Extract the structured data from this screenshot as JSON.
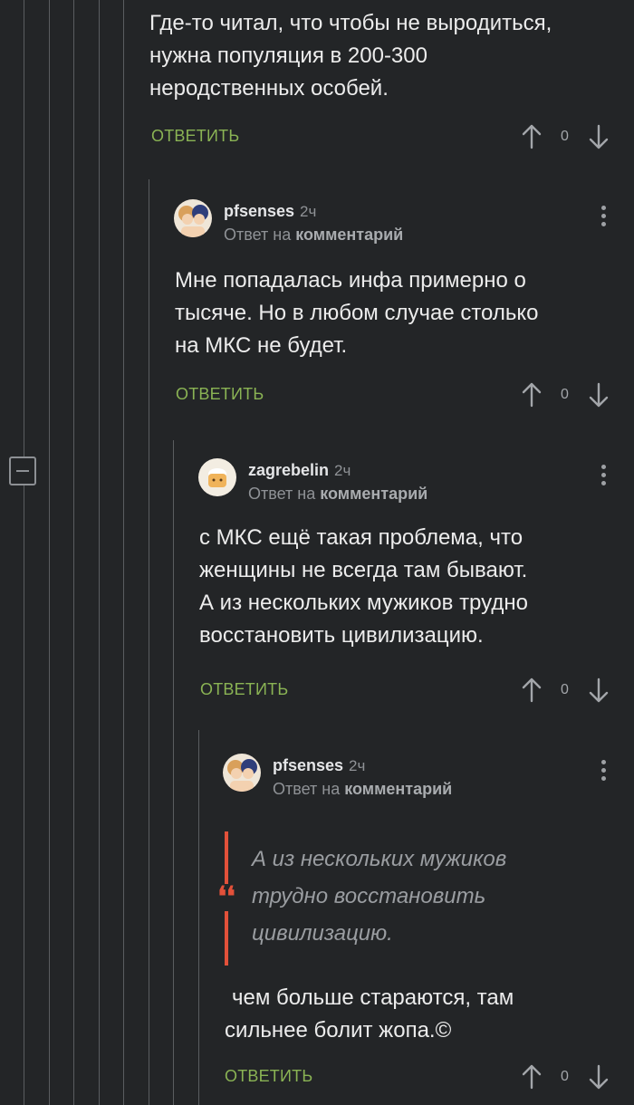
{
  "comment1": {
    "text_lines": [
      "Где-то читал, что чтобы не выродиться,",
      "нужна популяция в 200-300",
      "неродственных особей."
    ],
    "reply_label": "ОТВЕТИТЬ",
    "score": "0"
  },
  "comment2": {
    "username": "pfsenses",
    "time": "2ч",
    "reply_prefix": "Ответ на",
    "reply_target": "комментарий",
    "text_lines": [
      "Мне попадалась инфа примерно о",
      "тысяче. Но в любом случае столько",
      "на МКС не будет."
    ],
    "reply_label": "ОТВЕТИТЬ",
    "score": "0"
  },
  "comment3": {
    "username": "zagrebelin",
    "time": "2ч",
    "reply_prefix": "Ответ на",
    "reply_target": "комментарий",
    "text_lines": [
      "с МКС ещё такая проблема, что",
      "женщины не всегда там бывают.",
      "А из нескольких мужиков трудно",
      "восстановить цивилизацию."
    ],
    "reply_label": "ОТВЕТИТЬ",
    "score": "0"
  },
  "comment4": {
    "username": "pfsenses",
    "time": "2ч",
    "reply_prefix": "Ответ на",
    "reply_target": "комментарий",
    "quote_lines": [
      "А из нескольких мужиков",
      "трудно восстановить",
      "цивилизацию."
    ],
    "quote_mark": "❛❛",
    "text_lines": [
      "чем больше стараются, там",
      "сильнее болит жопа.©"
    ],
    "reply_label": "ОТВЕТИТЬ",
    "score": "0"
  },
  "icons": {
    "upvote": "arrow-up-icon",
    "downvote": "arrow-down-icon",
    "more": "more-vertical-icon",
    "collapse": "minus-square-icon"
  },
  "colors": {
    "background": "#232527",
    "reply_green": "#8ab354",
    "quote_red": "#e2513a",
    "thread_line": "#5a5d60"
  }
}
